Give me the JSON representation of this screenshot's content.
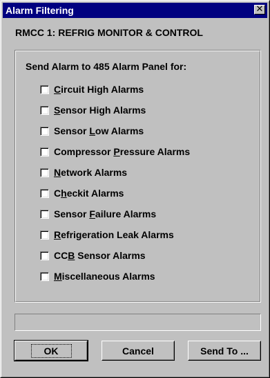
{
  "window": {
    "title": "Alarm Filtering",
    "close_glyph": "✕"
  },
  "device_name": "RMCC 1: REFRIG MONITOR & CONTROL",
  "group": {
    "heading": "Send Alarm to 485 Alarm Panel for:",
    "options": [
      {
        "before": "",
        "mnemonic": "C",
        "after": "ircuit High Alarms",
        "checked": false
      },
      {
        "before": "",
        "mnemonic": "S",
        "after": "ensor High Alarms",
        "checked": false
      },
      {
        "before": "Sensor ",
        "mnemonic": "L",
        "after": "ow Alarms",
        "checked": false
      },
      {
        "before": "Compressor ",
        "mnemonic": "P",
        "after": "ressure Alarms",
        "checked": false
      },
      {
        "before": "",
        "mnemonic": "N",
        "after": "etwork Alarms",
        "checked": false
      },
      {
        "before": "C",
        "mnemonic": "h",
        "after": "eckit Alarms",
        "checked": false
      },
      {
        "before": "Sensor ",
        "mnemonic": "F",
        "after": "ailure Alarms",
        "checked": false
      },
      {
        "before": "",
        "mnemonic": "R",
        "after": "efrigeration Leak Alarms",
        "checked": false
      },
      {
        "before": "CC",
        "mnemonic": "B",
        "after": " Sensor Alarms",
        "checked": false
      },
      {
        "before": "",
        "mnemonic": "M",
        "after": "iscellaneous Alarms",
        "checked": false
      }
    ]
  },
  "status_text": "",
  "buttons": {
    "ok": "OK",
    "cancel": "Cancel",
    "send_to": "Send To ..."
  }
}
